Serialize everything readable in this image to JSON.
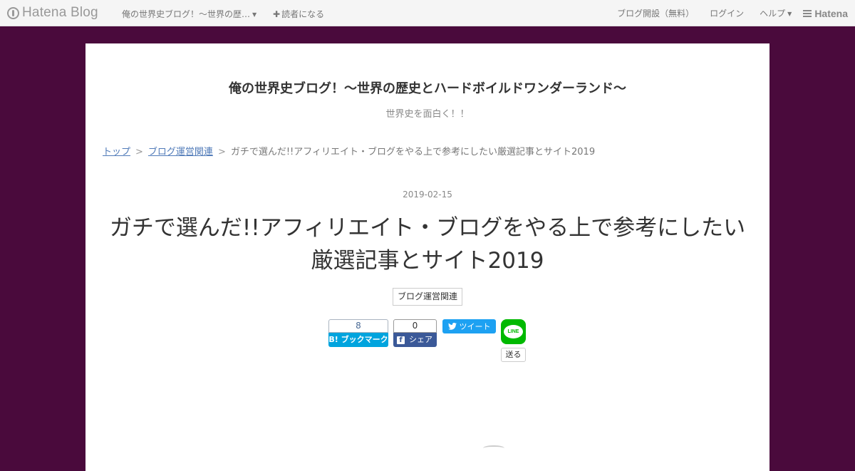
{
  "topbar": {
    "logo_text": "Hatena Blog",
    "blog_link": "俺の世界史ブログ！～世界の歴…",
    "reader_plus": "✚",
    "reader_label": "読者になる",
    "right_links": [
      "ブログ開設（無料）",
      "ログイン",
      "ヘルプ"
    ],
    "brand": "Hatena"
  },
  "blog": {
    "title": "俺の世界史ブログ！～世界の歴史とハードボイルドワンダーランド～",
    "description": "世界史を面白く！！"
  },
  "breadcrumb": {
    "items": [
      "トップ",
      "ブログ運営関連"
    ],
    "separator": ">",
    "current": "ガチで選んだ!!アフィリエイト・ブログをやる上で参考にしたい厳選記事とサイト2019"
  },
  "entry": {
    "date": "2019-02-15",
    "title": "ガチで選んだ!!アフィリエイト・ブログをやる上で参考にしたい厳選記事とサイト2019",
    "category": "ブログ運営関連"
  },
  "share": {
    "hatena_count": "8",
    "hatena_label": "B! ブックマーク",
    "facebook_count": "0",
    "facebook_label": "シェア",
    "twitter_label": "ツイート",
    "line_logo": "LINE",
    "line_label": "送る"
  },
  "colors": {
    "background": "#4a0a3c",
    "link": "#4f7ab8",
    "hatena_blue": "#00a4de",
    "facebook_blue": "#3b5998",
    "twitter_blue": "#1da1f2",
    "line_green": "#00b900"
  }
}
